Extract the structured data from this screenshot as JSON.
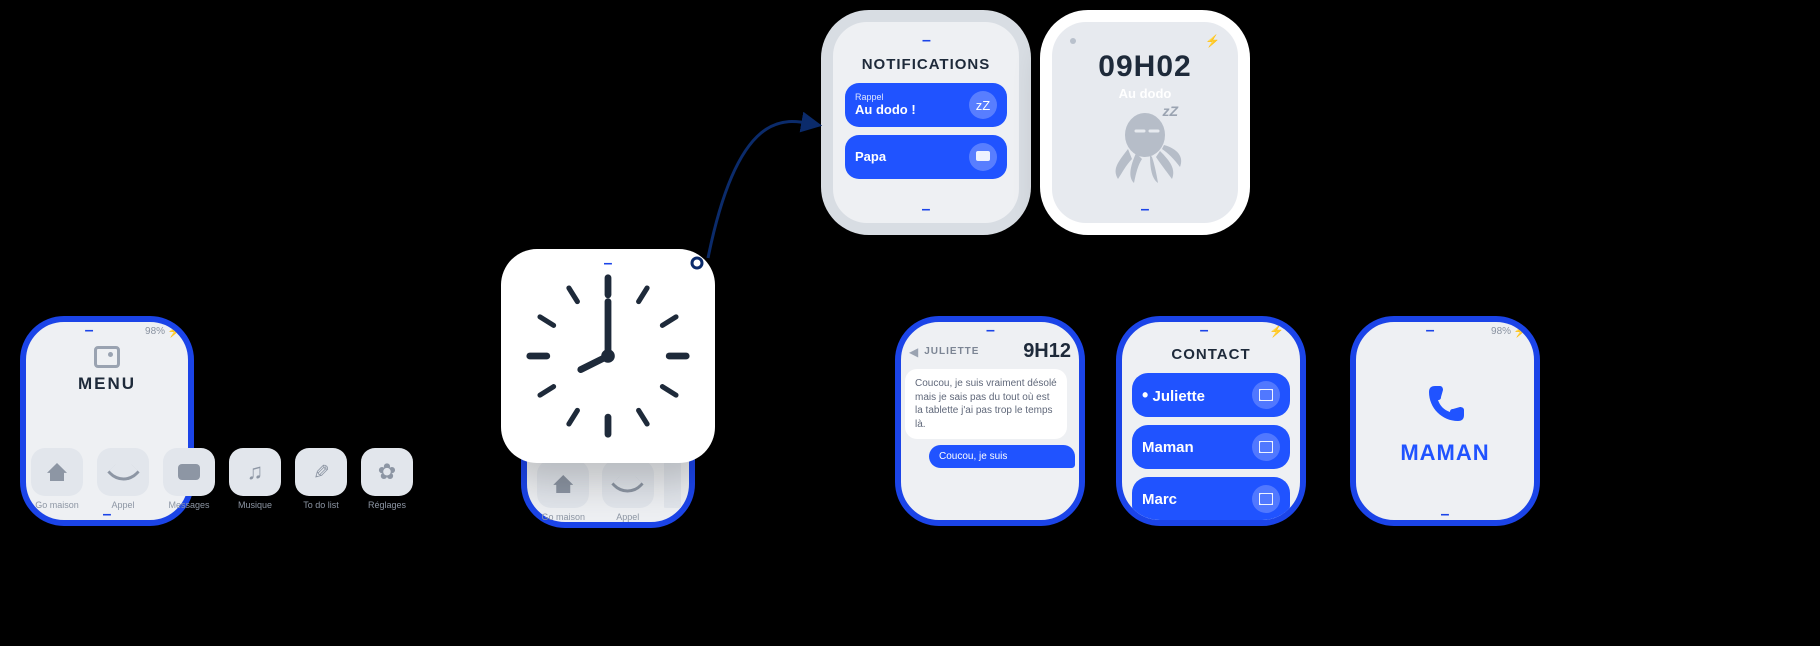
{
  "screens": {
    "menu": {
      "title": "MENU",
      "battery": "98%",
      "dock": [
        {
          "label": "Go maison",
          "icon": "home-icon"
        },
        {
          "label": "Appel",
          "icon": "phone-icon"
        },
        {
          "label": "Messages",
          "icon": "message-icon"
        },
        {
          "label": "Musique",
          "icon": "music-icon"
        },
        {
          "label": "To do list",
          "icon": "todo-icon"
        },
        {
          "label": "Réglages",
          "icon": "gear-icon"
        }
      ]
    },
    "clock_overlay": {
      "behind_dock": [
        {
          "label": "Go maison"
        },
        {
          "label": "Appel"
        }
      ]
    },
    "notifications": {
      "title": "NOTIFICATIONS",
      "items": [
        {
          "kicker": "Rappel",
          "label": "Au dodo !",
          "icon": "sleep-icon"
        },
        {
          "kicker": "",
          "label": "Papa",
          "icon": "message-icon"
        }
      ]
    },
    "sleep": {
      "time": "09H02",
      "subtitle": "Au dodo",
      "zz": "zZ"
    },
    "chat": {
      "contact": "JULIETTE",
      "time": "9H12",
      "incoming": "Coucou, je suis vraiment désolé mais je sais pas du tout où est la tablette j'ai pas trop le temps là.",
      "outgoing": "Coucou, je suis"
    },
    "contacts": {
      "title": "CONTACT",
      "items": [
        {
          "label": "Juliette",
          "active": true
        },
        {
          "label": "Maman",
          "active": false
        },
        {
          "label": "Marc",
          "active": false
        }
      ]
    },
    "call": {
      "battery": "98%",
      "name": "MAMAN"
    }
  }
}
